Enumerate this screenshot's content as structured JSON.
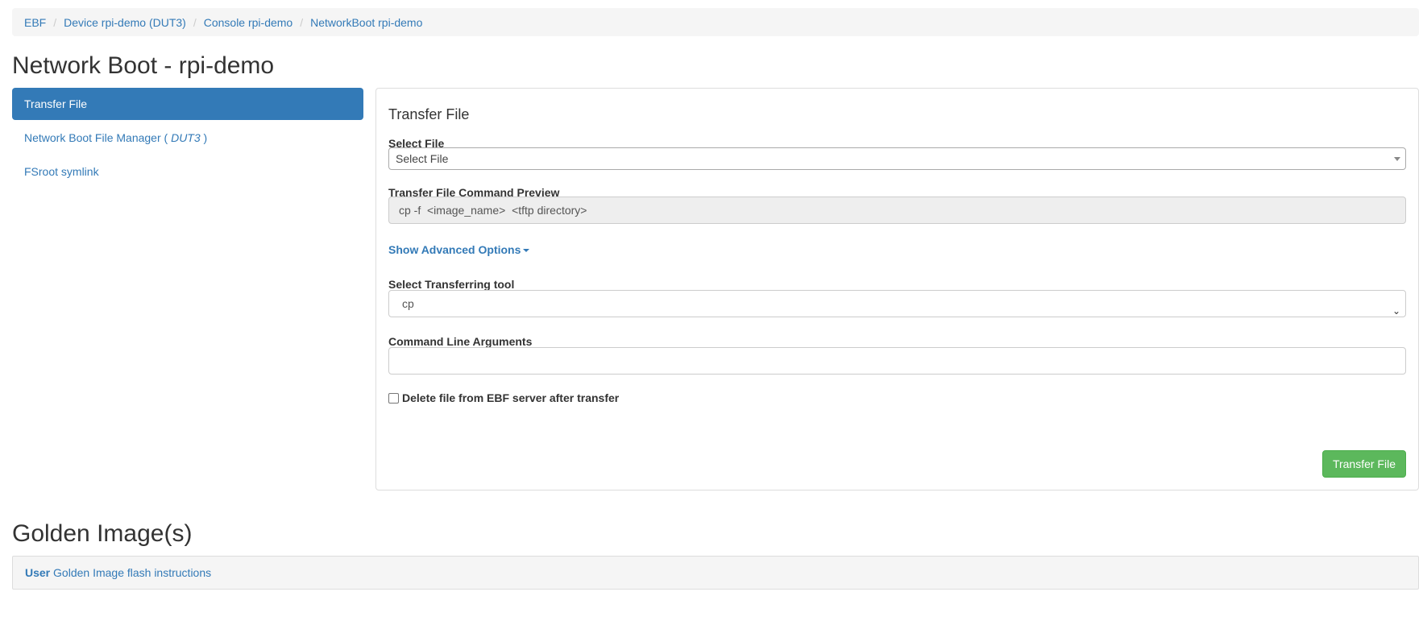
{
  "breadcrumb": {
    "items": [
      "EBF",
      "Device rpi-demo (DUT3)",
      "Console rpi-demo",
      "NetworkBoot rpi-demo"
    ],
    "separator": "/"
  },
  "page": {
    "title": "Network Boot - rpi-demo"
  },
  "sidebar": {
    "items": [
      {
        "label": "Transfer File",
        "active": true
      },
      {
        "label_prefix": "Network Boot File Manager ( ",
        "label_italic": "DUT3",
        "label_suffix": " )"
      },
      {
        "label": "FSroot symlink"
      }
    ]
  },
  "panel": {
    "title": "Transfer File",
    "select_file": {
      "label": "Select File",
      "value": "Select File"
    },
    "preview": {
      "label": "Transfer File Command Preview",
      "value": "cp -f  <image_name>  <tftp directory>"
    },
    "advanced_link": "Show Advanced Options",
    "tool": {
      "label": "Select Transferring tool",
      "value": "cp"
    },
    "args": {
      "label": "Command Line Arguments",
      "value": ""
    },
    "delete_checkbox": {
      "label": "Delete file from EBF server after transfer",
      "checked": false
    },
    "submit_label": "Transfer File"
  },
  "golden": {
    "title": "Golden Image(s)",
    "link_bold": "User",
    "link_text": " Golden Image flash instructions"
  },
  "colors": {
    "primary": "#337ab7",
    "success": "#5cb85c",
    "breadcrumb_bg": "#f5f5f5"
  }
}
